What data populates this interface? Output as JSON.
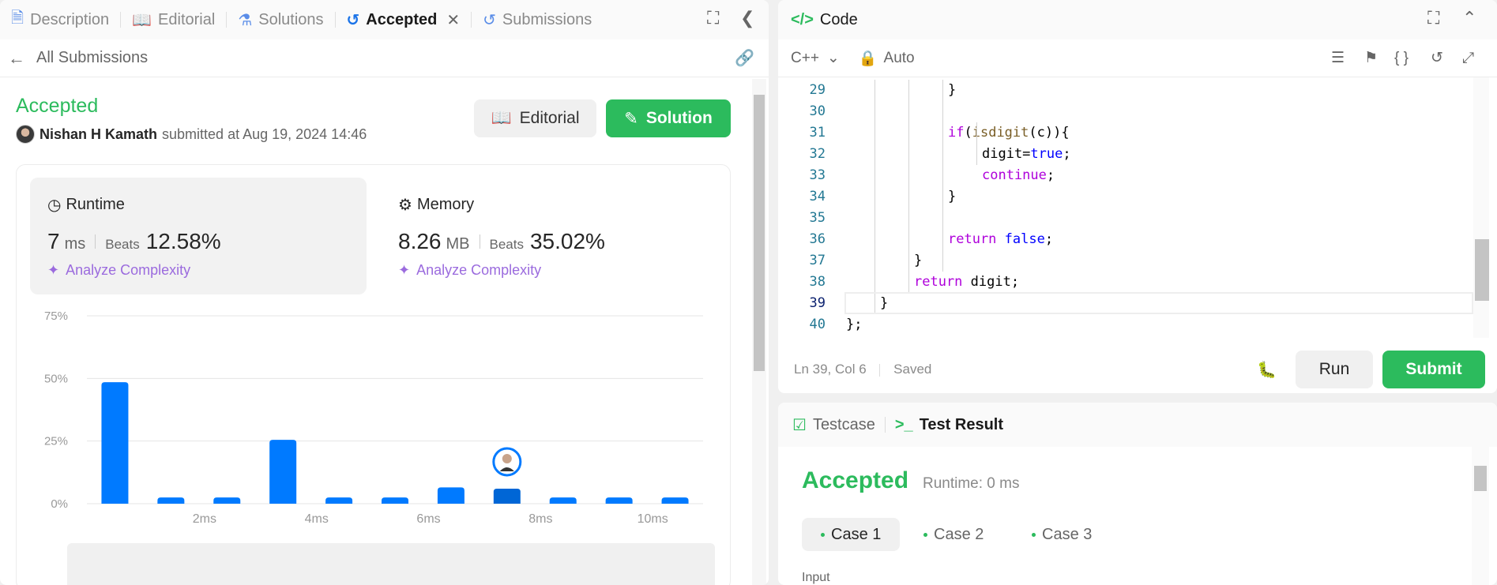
{
  "left_tabs": [
    {
      "label": "Description",
      "icon": "document-icon"
    },
    {
      "label": "Editorial",
      "icon": "book-icon"
    },
    {
      "label": "Solutions",
      "icon": "flask-icon"
    },
    {
      "label": "Accepted",
      "icon": "history-icon"
    },
    {
      "label": "Submissions",
      "icon": "history-icon"
    }
  ],
  "back_link": "All Submissions",
  "submission": {
    "status": "Accepted",
    "user": "Nishan H Kamath",
    "submitted_text": "submitted at Aug 19, 2024 14:46"
  },
  "buttons": {
    "editorial": "Editorial",
    "solution": "Solution",
    "run": "Run",
    "submit": "Submit"
  },
  "runtime": {
    "title": "Runtime",
    "value": "7",
    "unit": "ms",
    "beats_label": "Beats",
    "beats": "12.58%",
    "analyze": "Analyze Complexity"
  },
  "memory": {
    "title": "Memory",
    "value": "8.26",
    "unit": "MB",
    "beats_label": "Beats",
    "beats": "35.02%",
    "analyze": "Analyze Complexity"
  },
  "chart_data": {
    "type": "bar",
    "y_ticks": [
      "75%",
      "50%",
      "25%",
      "0%"
    ],
    "ylim": [
      0,
      75
    ],
    "x_tick_labels": [
      "2ms",
      "4ms",
      "6ms",
      "8ms",
      "10ms"
    ],
    "values": [
      48.5,
      2.5,
      2.5,
      25.5,
      2.5,
      2.5,
      6.5,
      6.0,
      2.5,
      2.5,
      2.5
    ],
    "highlight_index": 7,
    "colors": {
      "bar": "#007aff",
      "highlight": "#0066d6",
      "grid": "#e5e5e5"
    }
  },
  "editor": {
    "title": "Code",
    "language": "C++",
    "auto_label": "Auto",
    "status": "Ln 39, Col 6",
    "saved": "Saved",
    "lines": [
      {
        "n": "29",
        "indent": 3,
        "tokens": [
          {
            "t": "}",
            "c": ""
          }
        ]
      },
      {
        "n": "30",
        "indent": 0,
        "tokens": []
      },
      {
        "n": "31",
        "indent": 3,
        "tokens": [
          {
            "t": "if",
            "c": "kw"
          },
          {
            "t": "(",
            "c": ""
          },
          {
            "t": "isdigit",
            "c": "fn"
          },
          {
            "t": "(c)){",
            "c": ""
          }
        ]
      },
      {
        "n": "32",
        "indent": 4,
        "tokens": [
          {
            "t": "digit=",
            "c": ""
          },
          {
            "t": "true",
            "c": "kb"
          },
          {
            "t": ";",
            "c": ""
          }
        ]
      },
      {
        "n": "33",
        "indent": 4,
        "tokens": [
          {
            "t": "continue",
            "c": "kw"
          },
          {
            "t": ";",
            "c": ""
          }
        ]
      },
      {
        "n": "34",
        "indent": 3,
        "tokens": [
          {
            "t": "}",
            "c": ""
          }
        ]
      },
      {
        "n": "35",
        "indent": 0,
        "tokens": []
      },
      {
        "n": "36",
        "indent": 3,
        "tokens": [
          {
            "t": "return",
            "c": "kw"
          },
          {
            "t": " ",
            "c": ""
          },
          {
            "t": "false",
            "c": "kb"
          },
          {
            "t": ";",
            "c": ""
          }
        ]
      },
      {
        "n": "37",
        "indent": 2,
        "tokens": [
          {
            "t": "}",
            "c": ""
          }
        ]
      },
      {
        "n": "38",
        "indent": 2,
        "tokens": [
          {
            "t": "return",
            "c": "kw"
          },
          {
            "t": " digit;",
            "c": ""
          }
        ]
      },
      {
        "n": "39",
        "indent": 1,
        "tokens": [
          {
            "t": "}",
            "c": ""
          }
        ]
      },
      {
        "n": "40",
        "indent": 0,
        "tokens": [
          {
            "t": "};",
            "c": ""
          }
        ]
      }
    ]
  },
  "result": {
    "tab_testcase": "Testcase",
    "tab_result": "Test Result",
    "status": "Accepted",
    "runtime": "Runtime: 0 ms",
    "cases": [
      "Case 1",
      "Case 2",
      "Case 3"
    ],
    "input_label": "Input"
  }
}
